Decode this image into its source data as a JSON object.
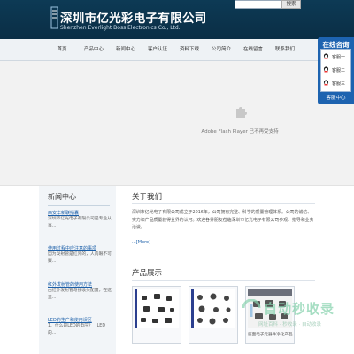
{
  "header": {
    "company_cn": "深圳市亿光彩电子有限公司",
    "company_en": "Shenzhen Everlight Boss Electronics Co., Ltd.",
    "search_button": "搜索",
    "logo_icon": "brand-logo-icon"
  },
  "nav": {
    "items": [
      {
        "label": "首页"
      },
      {
        "label": "产品中心"
      },
      {
        "label": "新闻中心"
      },
      {
        "label": "客户认证"
      },
      {
        "label": "资料下载"
      },
      {
        "label": "公司简介"
      },
      {
        "label": "在线留言"
      },
      {
        "label": "联系我们"
      }
    ]
  },
  "banner": {
    "plugin_icon": "puzzle-plugin-icon",
    "plugin_message": "Adobe Flash Player 已不再受支持"
  },
  "service": {
    "title": "在线咨询",
    "agents": [
      {
        "label": "客服一"
      },
      {
        "label": "客服二"
      },
      {
        "label": "客服三"
      }
    ],
    "footer": "客服中心",
    "accent": "#1d63b0"
  },
  "news": {
    "title": "新闻中心",
    "items": [
      {
        "link": "西安华新联播囊",
        "desc": "深圳市亿光电子有限公司是专业从事..."
      },
      {
        "link": "使用过程中应注意的事项",
        "desc": "因为发射管是红外的，人肉眼不可察..."
      },
      {
        "link": "红外发射管的使用方法",
        "desc": "由红外发射管与接收头配置，在这里..."
      },
      {
        "link": "LED的生产和使用误区",
        "desc": "1、什么是LED的电压？　LED的..."
      }
    ]
  },
  "about": {
    "title": "关于我们",
    "text": "深圳市亿光电子有限公司成立于2016年，公司拥有完整、科学的质量管理体系。公司的诚信、实力和产品质量获得业界的认可。欢迎各界朋友莅临深圳市亿光电子有限公司参观、指导和业务洽谈。",
    "more": "...[More]"
  },
  "products": {
    "title": "产品展示",
    "items": [
      {
        "caption": ""
      },
      {
        "caption": ""
      },
      {
        "caption": "底面电子元器件净化产品..."
      }
    ]
  },
  "watermark": {
    "title": "自动秒收录",
    "subtitle": "网址百科 · 秒收录 · 自动收录"
  }
}
